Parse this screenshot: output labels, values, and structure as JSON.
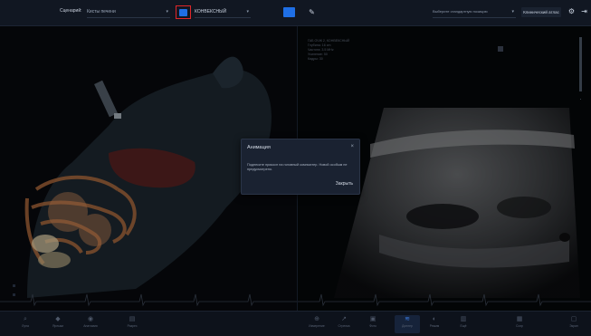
{
  "topbar": {
    "scenario_label": "Сценарий:",
    "scenario_value": "Кисты печени",
    "mode_value": "КОНВЕКСНЫЙ",
    "plan_placeholder": "Выберите стандартную позицию",
    "atlas_label": "Клинический атлас",
    "icons": [
      "heart-icon",
      "probe-icon",
      "gear-icon",
      "exit-icon"
    ]
  },
  "ultrasound": {
    "info_lines": [
      "ГАБ ОЧЖ 2, КОНВЕКСНЫЙ",
      "Глубина: 16 cm",
      "Частота: 3.5 MHz",
      "Усиление: 50",
      "Кадры: 30"
    ]
  },
  "modal": {
    "title": "Анимация",
    "body": "Поднесите прикосн на головный компьютер. Новой особым не предусмотрено.",
    "ok_label": "Закрыть"
  },
  "bottombar": {
    "items": [
      {
        "label": "Лупа",
        "icon": "zoom-icon"
      },
      {
        "label": "Ярлыки",
        "icon": "label-icon"
      },
      {
        "label": "Анатомия",
        "icon": "anatomy-icon"
      },
      {
        "label": "Разрез",
        "icon": "slice-icon"
      },
      {
        "label": "Измерение",
        "icon": "measure-icon"
      },
      {
        "label": "Стрелка",
        "icon": "arrow-icon"
      },
      {
        "label": "Фото",
        "icon": "camera-icon"
      },
      {
        "label": "Доплер",
        "icon": "doppler-icon"
      },
      {
        "label": "Режим",
        "icon": "mode-icon"
      },
      {
        "label": "Ещё",
        "icon": "more-icon"
      },
      {
        "label": "Сохр",
        "icon": "save-icon"
      },
      {
        "label": "Экран",
        "icon": "screen-icon"
      }
    ]
  }
}
